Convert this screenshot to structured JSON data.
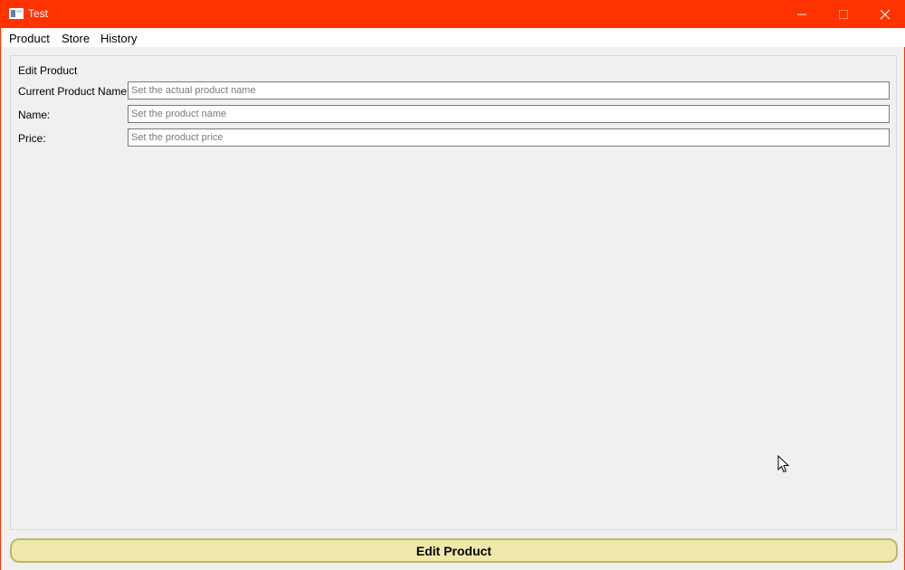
{
  "window": {
    "title": "Test",
    "accent_color": "#ff3300"
  },
  "titlebar_buttons": {
    "minimize": "minimize-icon",
    "maximize": "maximize-icon",
    "close": "close-icon"
  },
  "menu": [
    "Product",
    "Store",
    "History"
  ],
  "group": {
    "title": "Edit Product",
    "fields": [
      {
        "label": "Current Product Name:",
        "value": "",
        "placeholder": "Set the actual product name"
      },
      {
        "label": "Name:",
        "value": "",
        "placeholder": "Set the product name"
      },
      {
        "label": "Price:",
        "value": "",
        "placeholder": "Set the product price"
      }
    ]
  },
  "action": {
    "label": "Edit Product",
    "background": "#eee8aa",
    "border": "#bdb76b"
  }
}
